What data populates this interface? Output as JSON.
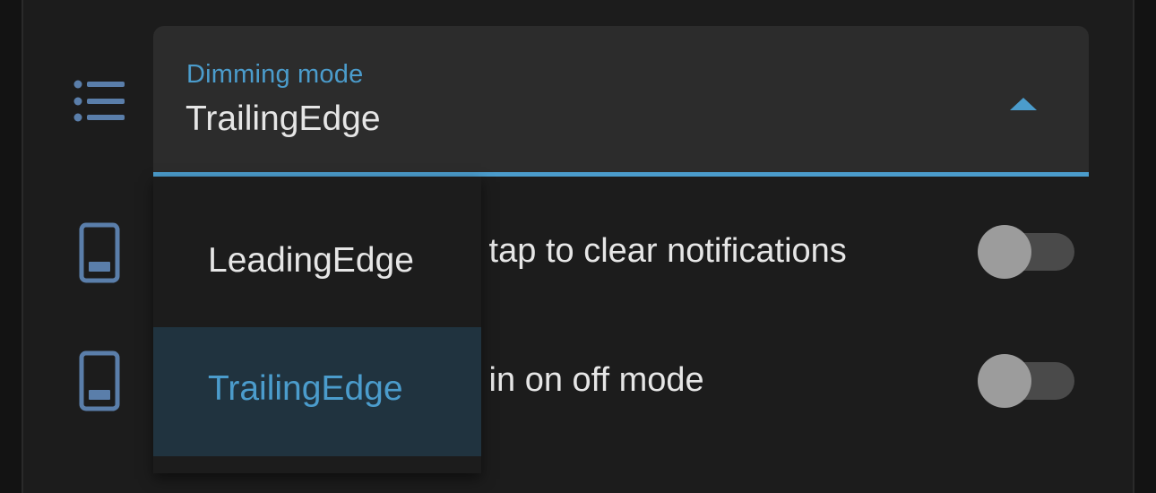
{
  "dimming_select": {
    "label": "Dimming mode",
    "value": "TrailingEdge",
    "icon": "format-list-bulleted-icon"
  },
  "settings": [
    {
      "label_visible": "k tap to clear notifications",
      "icon": "cellphone-icon",
      "toggle_on": false
    },
    {
      "label_visible": "k in on off mode",
      "icon": "cellphone-icon",
      "toggle_on": false
    }
  ],
  "dropdown": {
    "options": [
      "LeadingEdge",
      "TrailingEdge"
    ],
    "selected": "TrailingEdge"
  },
  "colors": {
    "accent": "#4b9ccc",
    "icon": "#5a7eaa",
    "selected_bg": "#20333f"
  }
}
